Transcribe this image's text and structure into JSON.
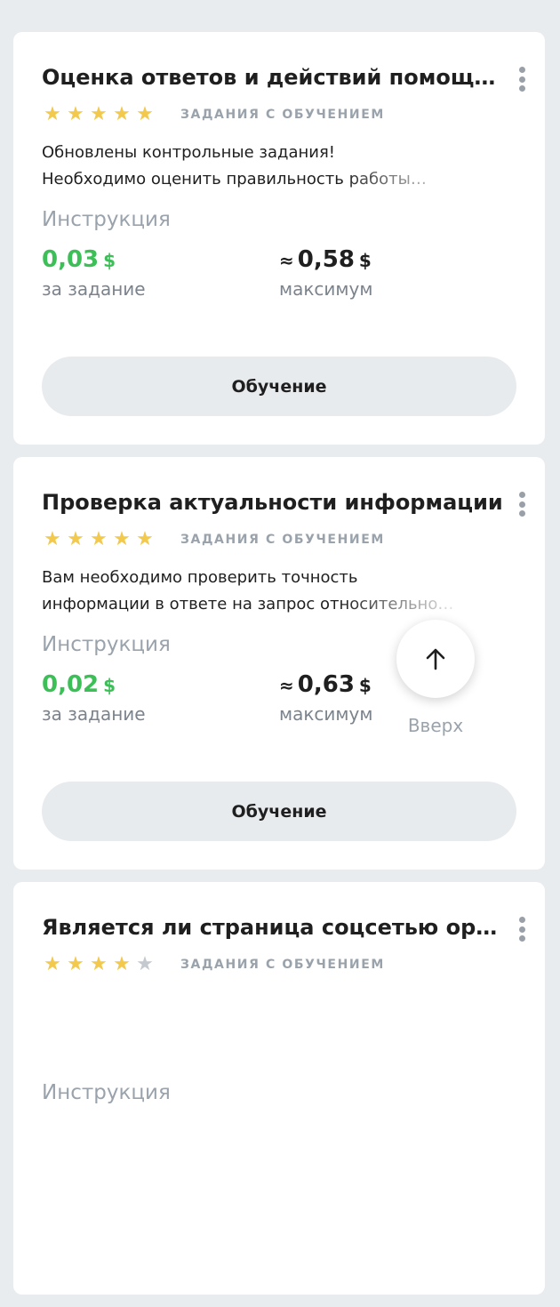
{
  "cards": [
    {
      "title": "Оценка ответов и действий помощника",
      "rating": 5,
      "task_type": "ЗАДАНИЯ С ОБУЧЕНИЕМ",
      "desc_line1": "Обновлены контрольные задания!",
      "desc_line2": "Необходимо оценить правильность работы…",
      "instruction": "Инструкция",
      "price": "0,03",
      "currency": "$",
      "price_label": "за задание",
      "approx": "≈",
      "max_price": "0,58",
      "max_label": "максимум",
      "button": "Обучение"
    },
    {
      "title": "Проверка актуальности информации",
      "rating": 5,
      "task_type": "ЗАДАНИЯ С ОБУЧЕНИЕМ",
      "desc_line1": "Вам необходимо проверить точность",
      "desc_line2": "информации в ответе на запрос относительно…",
      "instruction": "Инструкция",
      "price": "0,02",
      "currency": "$",
      "price_label": "за задание",
      "approx": "≈",
      "max_price": "0,63",
      "max_label": "максимум",
      "button": "Обучение"
    },
    {
      "title": "Является ли страница соцсетью организации",
      "rating": 4,
      "task_type": "ЗАДАНИЯ С ОБУЧЕНИЕМ",
      "instruction": "Инструкция"
    }
  ],
  "scroll_top": {
    "label": "Вверх",
    "icon": "arrow-up-icon"
  },
  "colors": {
    "accent_green": "#3dbf58",
    "star": "#f2c94c",
    "muted": "#9aa3ac"
  }
}
